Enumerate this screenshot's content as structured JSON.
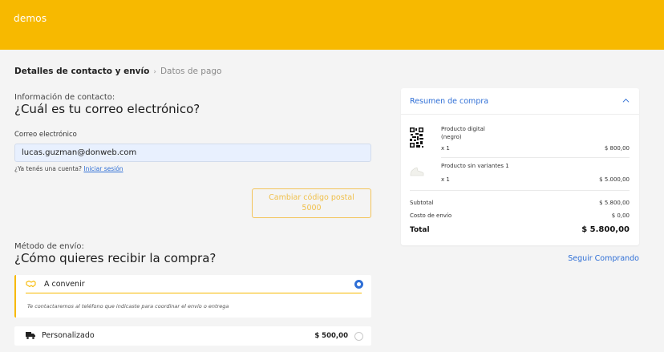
{
  "header": {
    "brand": "demos"
  },
  "breadcrumb": {
    "active": "Detalles de contacto y envío",
    "separator": "›",
    "next": "Datos de pago"
  },
  "contact": {
    "label": "Información de contacto:",
    "title": "¿Cuál es tu correo electrónico?",
    "email_label": "Correo electrónico",
    "email_value": "lucas.guzman@donweb.com",
    "account_question": "¿Ya tenés una cuenta?",
    "login_link": "Iniciar sesión"
  },
  "postal": {
    "button_line1": "Cambiar código postal",
    "button_line2": "5000"
  },
  "shipping": {
    "label": "Método de envío:",
    "title": "¿Cómo quieres recibir la compra?",
    "options": [
      {
        "name": "A convenir",
        "note": "Te contactaremos al teléfono que indicaste para coordinar el envío o entrega",
        "selected": true,
        "icon": "handshake-icon"
      },
      {
        "name": "Personalizado",
        "price": "$ 500,00",
        "selected": false,
        "icon": "truck-icon"
      }
    ]
  },
  "summary": {
    "title": "Resumen de compra",
    "items": [
      {
        "name_line1": "Producto digital",
        "name_line2": "(negro)",
        "qty": "x 1",
        "price": "$ 800,00",
        "icon": "qr-code-icon"
      },
      {
        "name_line1": "Producto sin variantes 1",
        "qty": "x 1",
        "price": "$ 5.000,00",
        "icon": "shoe-icon"
      }
    ],
    "subtotal_label": "Subtotal",
    "subtotal_value": "$ 5.800,00",
    "shipping_label": "Costo de envío",
    "shipping_value": "$ 0,00",
    "total_label": "Total",
    "total_value": "$ 5.800,00"
  },
  "continue_label": "Seguir Comprando",
  "colors": {
    "brand": "#f7b900",
    "link": "#2f6fd6",
    "background": "#f4f4f4"
  }
}
